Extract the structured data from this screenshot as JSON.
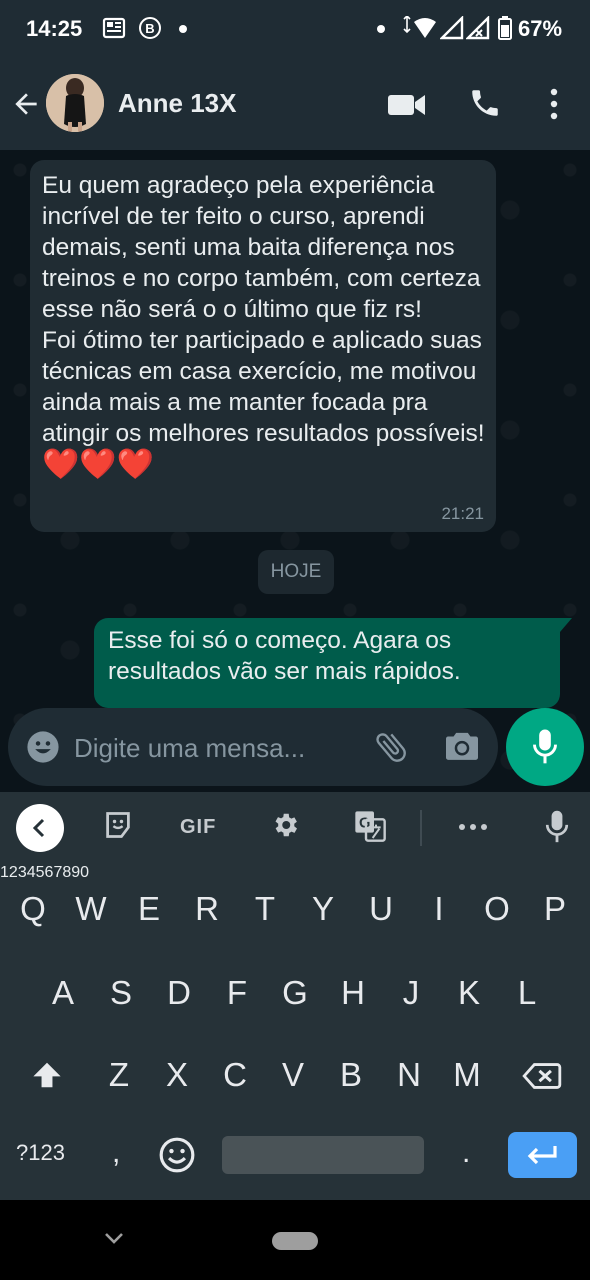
{
  "status_bar": {
    "time": "14:25",
    "battery": "67%"
  },
  "header": {
    "contact_name": "Anne 13X"
  },
  "chat": {
    "messages": [
      {
        "direction": "incoming",
        "text": "Eu quem agradeço pela experiência incrível de ter feito o curso, aprendi demais, senti uma baita diferença nos treinos e no corpo também, com certeza esse não será o o último que fiz rs!\nFoi ótimo ter participado e aplicado suas técnicas em casa exercício, me motivou ainda mais a me manter focada pra atingir os melhores resultados possíveis!",
        "emoji": "❤️❤️❤️",
        "time": "21:21"
      },
      {
        "direction": "outgoing",
        "text": "Esse foi só o começo. Agara os resultados vão ser mais rápidos."
      }
    ],
    "date_divider": "HOJE"
  },
  "input": {
    "placeholder": "Digite uma mensa..."
  },
  "keyboard": {
    "toolbar": {
      "gif_label": "GIF"
    },
    "row1": [
      "Q",
      "W",
      "E",
      "R",
      "T",
      "Y",
      "U",
      "I",
      "O",
      "P"
    ],
    "row1_hints": [
      "1",
      "2",
      "3",
      "4",
      "5",
      "6",
      "7",
      "8",
      "9",
      "0"
    ],
    "row2": [
      "A",
      "S",
      "D",
      "F",
      "G",
      "H",
      "J",
      "K",
      "L"
    ],
    "row3": [
      "Z",
      "X",
      "C",
      "V",
      "B",
      "N",
      "M"
    ],
    "bottom": {
      "symbols": "?123",
      "comma": ",",
      "period": "."
    }
  },
  "colors": {
    "header_bg": "#1f2c34",
    "chat_bg": "#0b141a",
    "incoming_bubble": "#202c33",
    "outgoing_bubble": "#005c4b",
    "accent": "#00a884",
    "keyboard_bg": "#263238",
    "enter_key": "#4a9ff5"
  }
}
